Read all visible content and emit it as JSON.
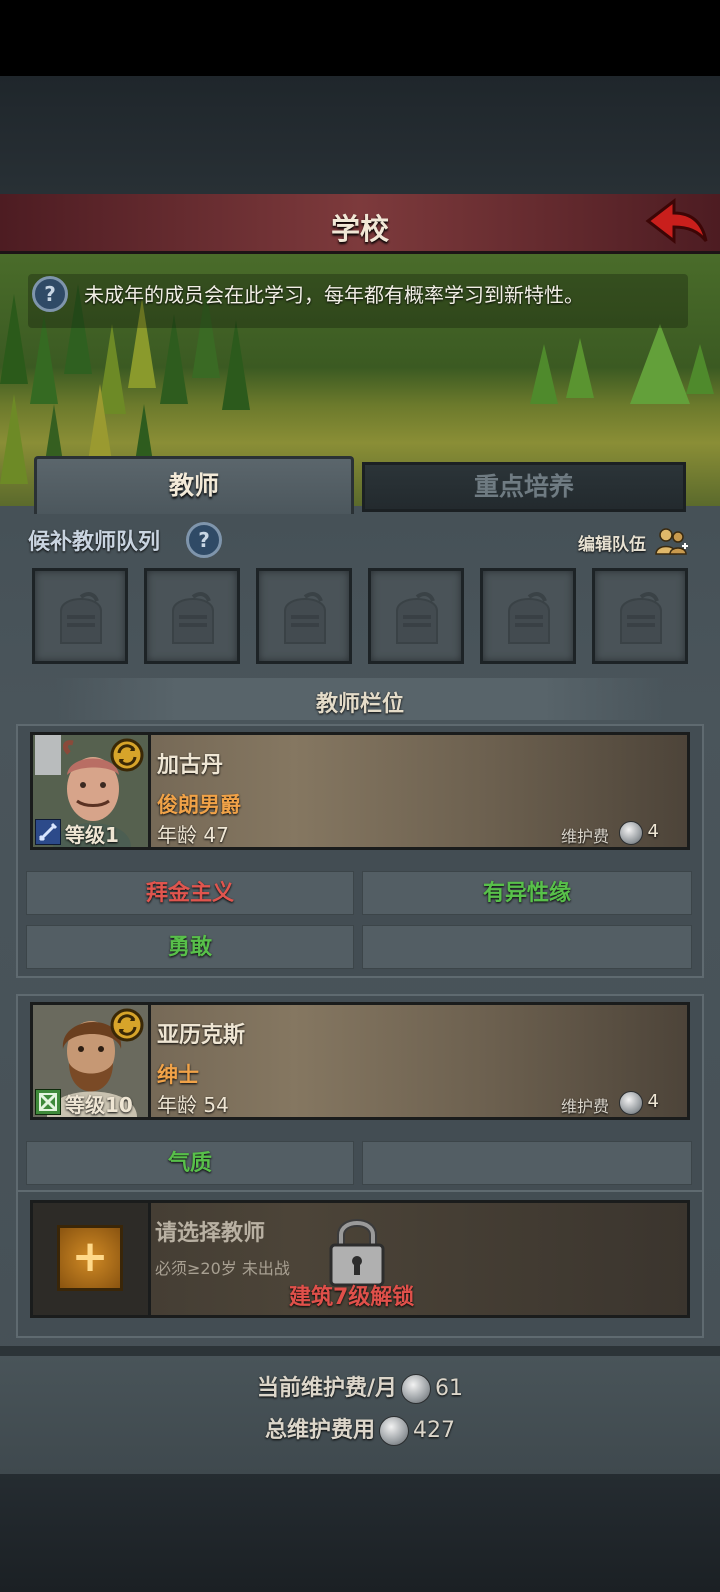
{
  "header": {
    "title": "学校"
  },
  "info": {
    "text": "未成年的成员会在此学习，每年都有概率学习到新特性。"
  },
  "tabs": [
    {
      "label": "教师",
      "active": true
    },
    {
      "label": "重点培养",
      "active": false
    }
  ],
  "queue": {
    "title": "候补教师队列",
    "edit_label": "编辑队伍",
    "slots_count": 6
  },
  "slots_section": {
    "title": "教师栏位"
  },
  "teachers": [
    {
      "name": "加古丹",
      "title": "俊朗男爵",
      "level_label": "等级1",
      "age_label": "年龄",
      "age": "47",
      "upkeep_label": "维护费",
      "upkeep": "4",
      "traits": [
        {
          "label": "拜金主义",
          "color": "#e0554e"
        },
        {
          "label": "有异性缘",
          "color": "#58c04a"
        },
        {
          "label": "勇敢",
          "color": "#58c04a"
        },
        {
          "label": "",
          "color": "#58c04a"
        }
      ]
    },
    {
      "name": "亚历克斯",
      "title": "绅士",
      "level_label": "等级10",
      "age_label": "年龄",
      "age": "54",
      "upkeep_label": "维护费",
      "upkeep": "4",
      "traits": [
        {
          "label": "气质",
          "color": "#58c04a"
        },
        {
          "label": "",
          "color": "#58c04a"
        }
      ]
    }
  ],
  "locked_slot": {
    "add_symbol": "+",
    "label": "请选择教师",
    "requirement": "必须≥20岁 未出战",
    "unlock_text": "建筑7级解锁"
  },
  "footer": {
    "monthly_label": "当前维护费/月",
    "monthly_value": "61",
    "total_label": "总维护费用",
    "total_value": "427"
  },
  "colors": {
    "accent_orange": "#f0a248",
    "positive_trait": "#58c04a",
    "negative_trait": "#e0554e",
    "header_red": "#7d3a3c"
  },
  "icons": [
    "help-icon",
    "back-arrow-icon",
    "edit-team-icon",
    "knight-helmet-icon",
    "swap-icon",
    "sword-class-icon",
    "shield-class-icon",
    "coin-icon",
    "lock-icon",
    "plus-icon"
  ]
}
